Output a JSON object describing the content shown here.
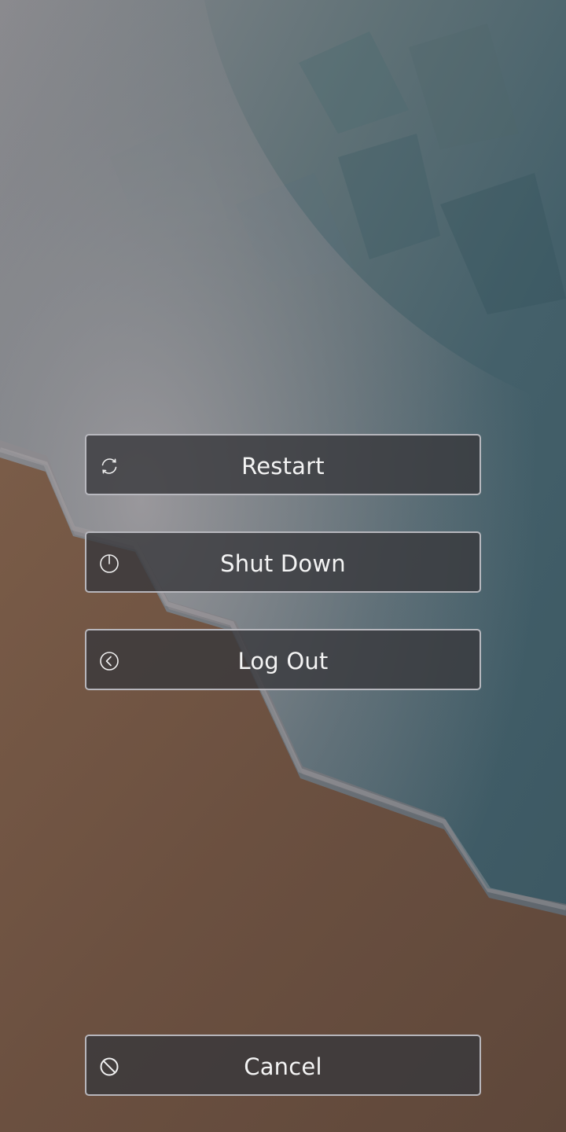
{
  "session_menu": {
    "restart_label": "Restart",
    "restart_icon": "restart-icon",
    "shutdown_label": "Shut Down",
    "shutdown_icon": "power-icon",
    "logout_label": "Log Out",
    "logout_icon": "logout-icon",
    "cancel_label": "Cancel",
    "cancel_icon": "cancel-icon"
  },
  "colors": {
    "button_background": "#38383c",
    "button_border": "#cdcdd2",
    "button_text": "#f4f4f4",
    "sand": "#6e5444",
    "sea": "#3e5b63"
  }
}
